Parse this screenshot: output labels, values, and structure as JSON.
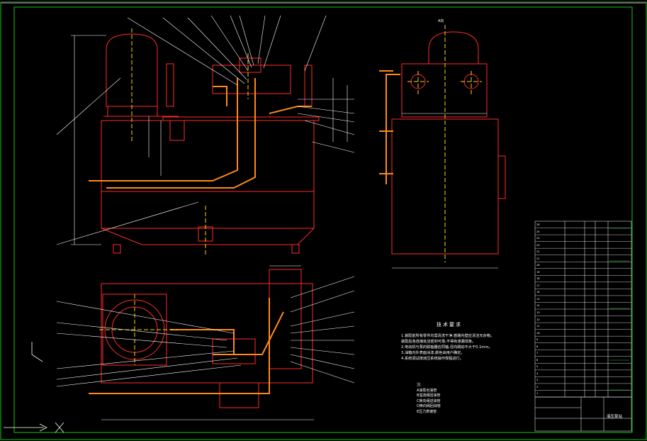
{
  "colors": {
    "background": "#000000",
    "outline": "#ff2a2a",
    "pipe": "#ff8a1a",
    "centerline": "#ffd21e",
    "leader": "#ffffff",
    "border": "#19c219",
    "dimension": "#ffffff",
    "table_line": "#ffffff"
  },
  "view_label": "A向",
  "tech_requirements": {
    "title": "技术要求",
    "lines": [
      "1.装配前所有零件均需清洗干净,管路内壁应清洁无杂物。",
      "装配后各连接处应密封可靠,不得有渗漏现象。",
      "2.电动机与泵的联轴器应同轴,径向跳动不大于0.1mm。",
      "3.油箱内外表面涂漆,颜色由用户确定。",
      "4.系统调试按液压系统操作规程进行。"
    ]
  },
  "legend": {
    "title": "注:",
    "items": [
      "A油泵出油管",
      "B溢流阀回油管",
      "C换向阀进油管",
      "D换向阀回油管",
      "E压力表接管"
    ]
  },
  "title_block": {
    "drawing_title": "液压泵站"
  },
  "bom_rows": [
    "26",
    "25",
    "24",
    "23",
    "22",
    "21",
    "20",
    "19",
    "18",
    "17",
    "16",
    "15",
    "14",
    "13",
    "12",
    "11",
    "10",
    "9",
    "8",
    "7",
    "6",
    "5",
    "4",
    "3",
    "2",
    "1"
  ]
}
